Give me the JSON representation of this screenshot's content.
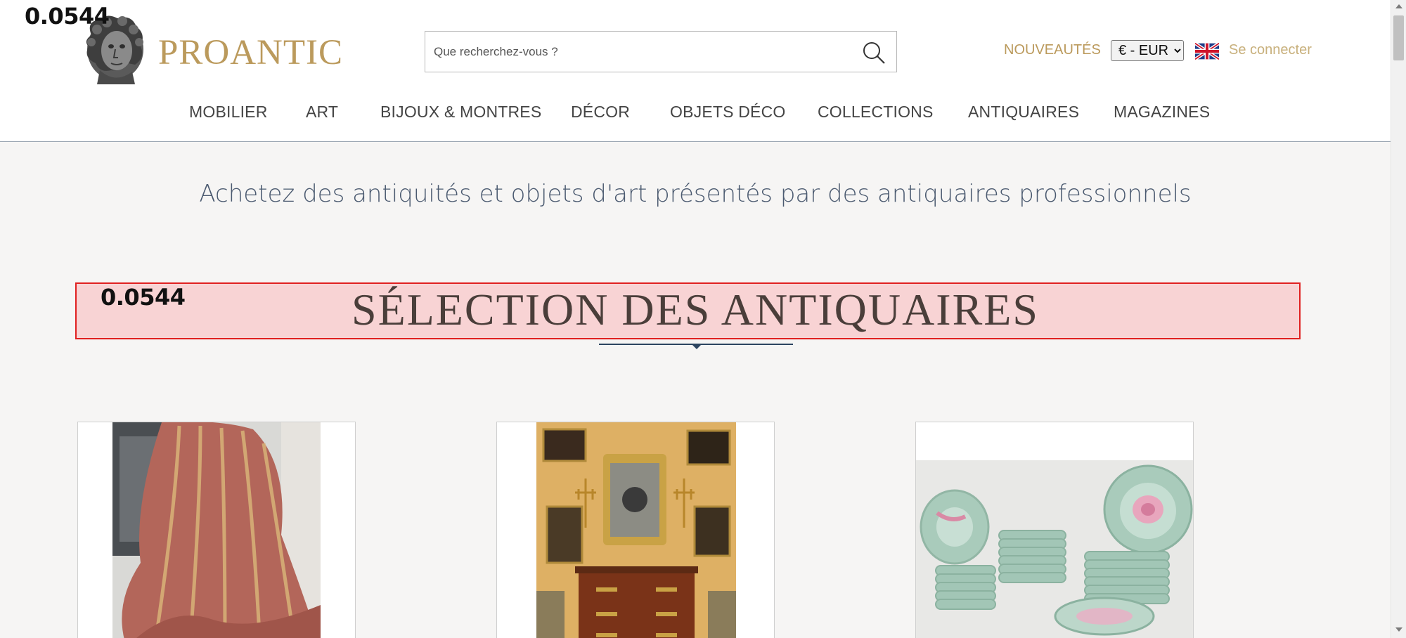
{
  "overlay": {
    "top_score": "0.0544",
    "section_score": "0.0544"
  },
  "brand": {
    "name": "PROANTIC",
    "logo_icon": "bust-sculpture-icon"
  },
  "search": {
    "placeholder": "Que recherchez-vous ?",
    "value": ""
  },
  "header_actions": {
    "new_items": "NOUVEAUTÉS",
    "currency_selected": "€ - EUR",
    "language_flag": "uk-flag-icon",
    "login": "Se connecter"
  },
  "nav": {
    "items": [
      {
        "label": "MOBILIER"
      },
      {
        "label": "ART"
      },
      {
        "label": "BIJOUX & MONTRES"
      },
      {
        "label": "DÉCOR"
      },
      {
        "label": "OBJETS DÉCO"
      },
      {
        "label": "COLLECTIONS"
      },
      {
        "label": "ANTIQUAIRES"
      },
      {
        "label": "MAGAZINES"
      }
    ]
  },
  "tagline": "Achetez des antiquités et objets d'art présentés par des antiquaires professionnels",
  "section": {
    "title": "SÉLECTION DES ANTIQUAIRES"
  },
  "products": [
    {
      "image": "striped-silk-fabric-drape"
    },
    {
      "image": "louis-xv-commode-with-mirror-and-candelabra"
    },
    {
      "image": "celadon-porcelain-dinner-service"
    }
  ],
  "colors": {
    "brand_gold": "#bb9a5c",
    "nav_text": "#444444",
    "tagline": "#4b5a70",
    "highlight_fill": "#f8d3d4",
    "highlight_border": "#e02020"
  }
}
